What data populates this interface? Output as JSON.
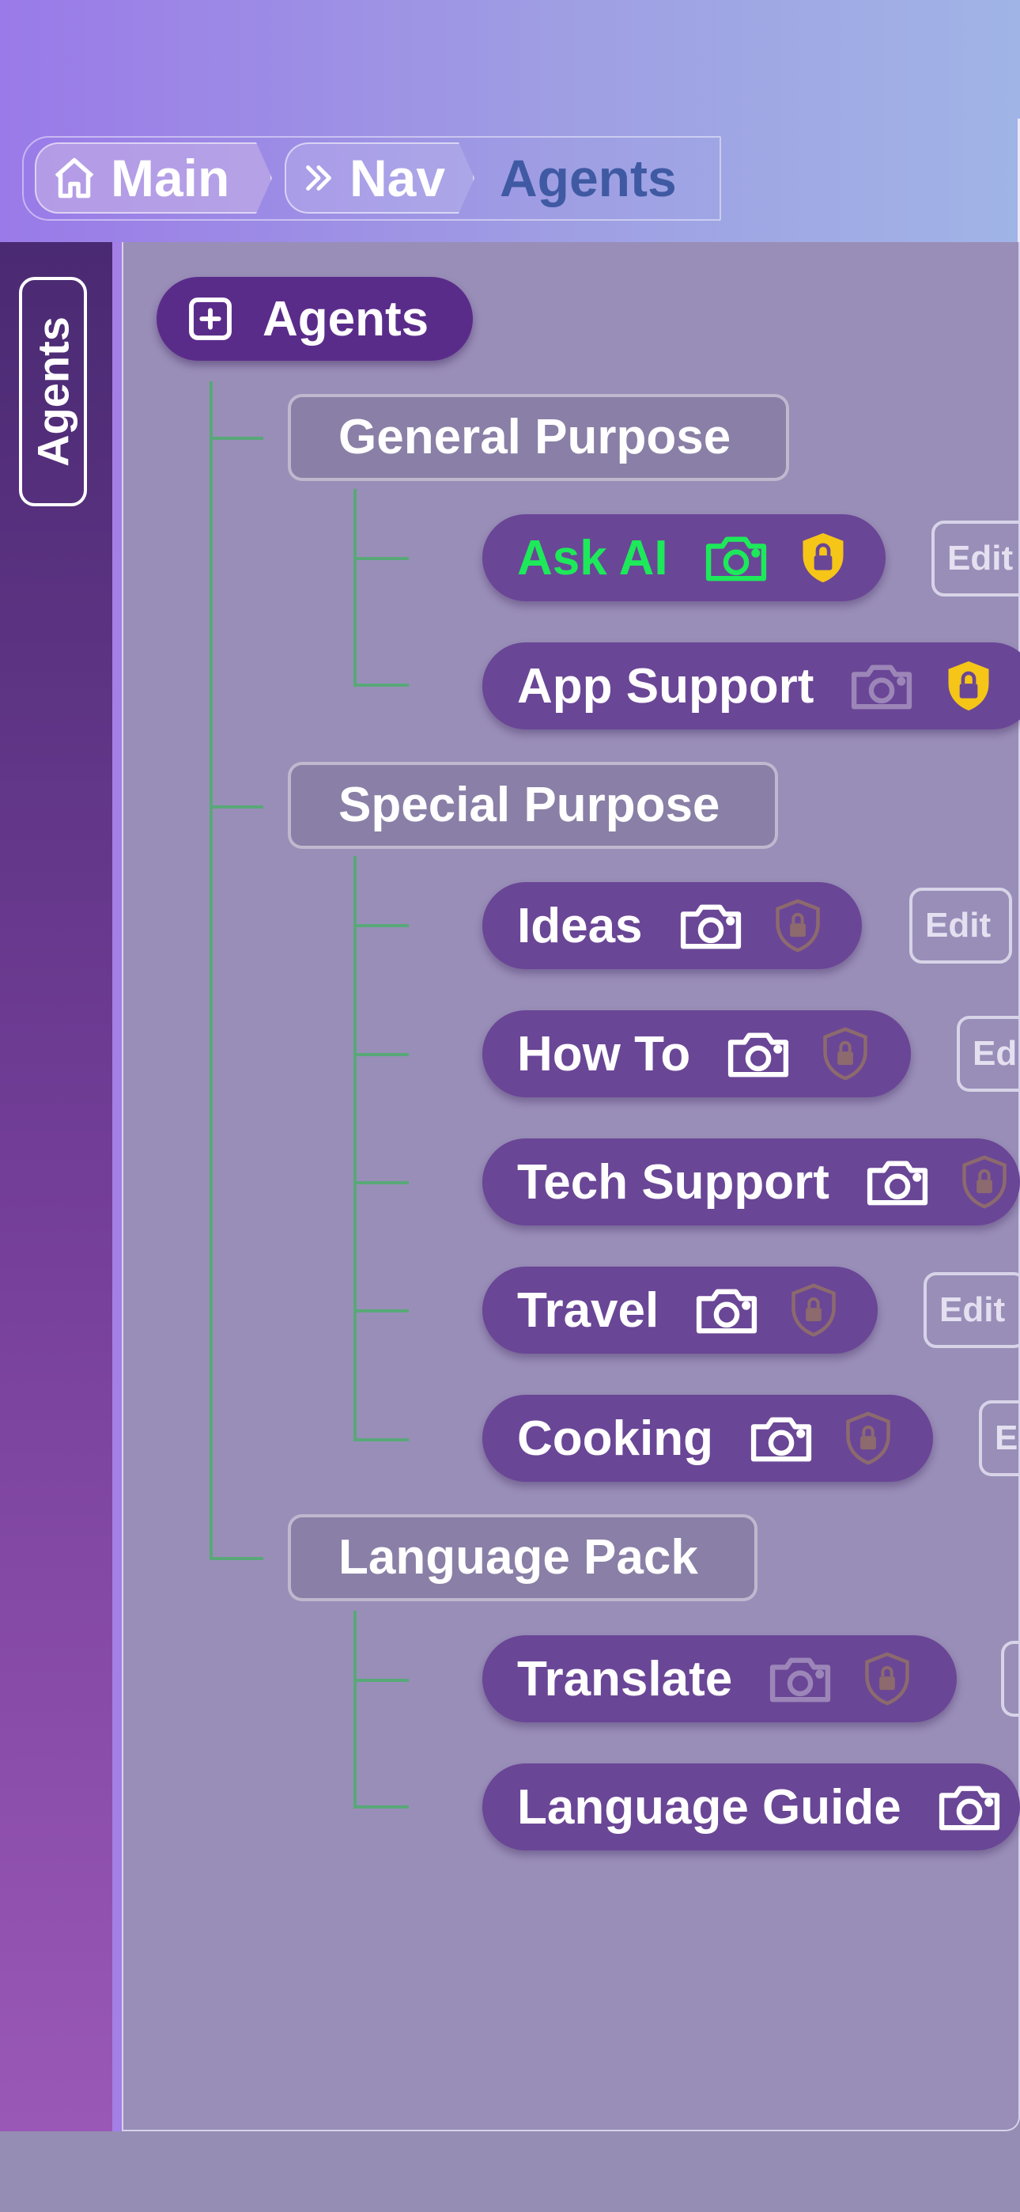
{
  "breadcrumb": {
    "items": [
      {
        "label": "Main",
        "icon": "home-icon"
      },
      {
        "label": "Nav",
        "icon": "double-chevron-right-icon"
      }
    ],
    "current": "Agents"
  },
  "sidebar": {
    "tab_label": "Agents"
  },
  "tree": {
    "root": {
      "label": "Agents",
      "icon": "plus-square-icon"
    },
    "groups": [
      {
        "label": "General Purpose",
        "items": [
          {
            "label": "Ask AI",
            "camera": "active",
            "lock": "active",
            "edit": "Edit",
            "highlight": "#1de95a"
          },
          {
            "label": "App Support",
            "camera": "dim",
            "lock": "active"
          }
        ]
      },
      {
        "label": "Special Purpose",
        "items": [
          {
            "label": "Ideas",
            "camera": "on",
            "lock": "dim",
            "edit": "Edit"
          },
          {
            "label": "How To",
            "camera": "on",
            "lock": "dim",
            "edit": "Ed"
          },
          {
            "label": "Tech Support",
            "camera": "on",
            "lock": "dim"
          },
          {
            "label": "Travel",
            "camera": "on",
            "lock": "dim",
            "edit": "Edit"
          },
          {
            "label": "Cooking",
            "camera": "on",
            "lock": "dim",
            "edit": "E"
          }
        ]
      },
      {
        "label": "Language Pack",
        "items": [
          {
            "label": "Translate",
            "camera": "dim",
            "lock": "dim"
          },
          {
            "label": "Language Guide",
            "camera": "on"
          }
        ]
      }
    ]
  },
  "colors": {
    "accent_green": "#1de95a",
    "lock_active": "#f5c518",
    "lock_dim": "#8c6a6e",
    "tree_line": "#58a878",
    "pill_bg": "#6a4696",
    "root_bg": "#5a2c8a"
  }
}
